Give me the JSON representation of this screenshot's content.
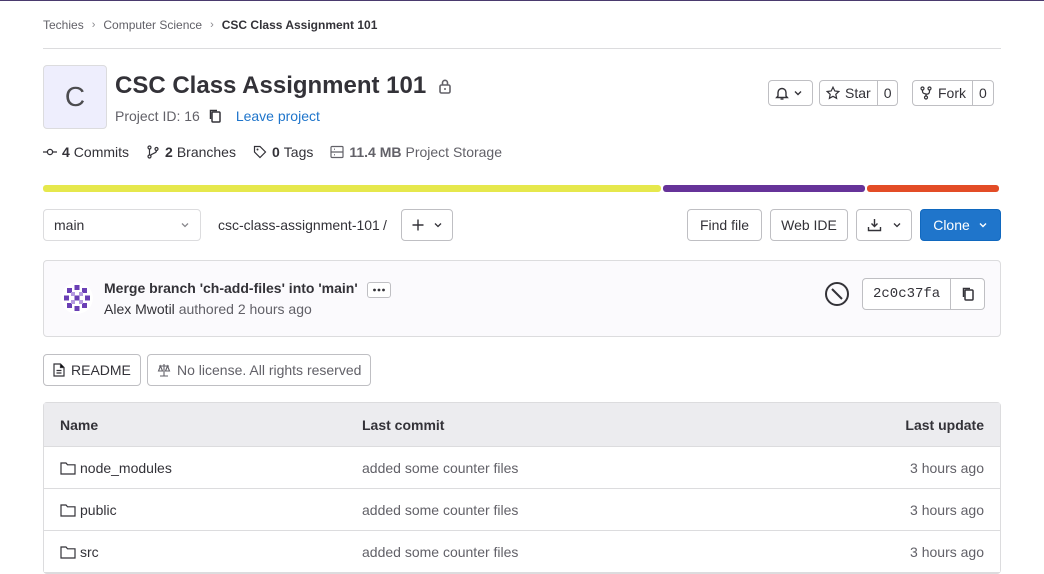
{
  "breadcrumb": [
    "Techies",
    "Computer Science",
    "CSC Class Assignment 101"
  ],
  "project": {
    "avatar_letter": "C",
    "title": "CSC Class Assignment 101",
    "id_text": "Project ID: 16",
    "leave_label": "Leave project"
  },
  "actions": {
    "star_label": "Star",
    "star_count": "0",
    "fork_label": "Fork",
    "fork_count": "0"
  },
  "stats": {
    "commits_count": "4",
    "commits_label": "Commits",
    "branches_count": "2",
    "branches_label": "Branches",
    "tags_count": "0",
    "tags_label": "Tags",
    "storage_size": "11.4 MB",
    "storage_label": "Project Storage"
  },
  "languages": [
    {
      "color": "#e6e84c",
      "share": 0.647
    },
    {
      "color": "#663399",
      "share": 0.213
    },
    {
      "color": "#e34c26",
      "share": 0.14
    }
  ],
  "toolbar": {
    "branch": "main",
    "path": "csc-class-assignment-101",
    "path_sep": "/",
    "find_file": "Find file",
    "web_ide": "Web IDE",
    "clone": "Clone"
  },
  "commit": {
    "title": "Merge branch 'ch-add-files' into 'main'",
    "author": "Alex Mwotil",
    "meta": "authored 2 hours ago",
    "sha": "2c0c37fa"
  },
  "info_buttons": {
    "readme": "README",
    "license": "No license. All rights reserved"
  },
  "table": {
    "headers": [
      "Name",
      "Last commit",
      "Last update"
    ],
    "rows": [
      {
        "name": "node_modules",
        "commit": "added some counter files",
        "updated": "3 hours ago"
      },
      {
        "name": "public",
        "commit": "added some counter files",
        "updated": "3 hours ago"
      },
      {
        "name": "src",
        "commit": "added some counter files",
        "updated": "3 hours ago"
      }
    ]
  }
}
